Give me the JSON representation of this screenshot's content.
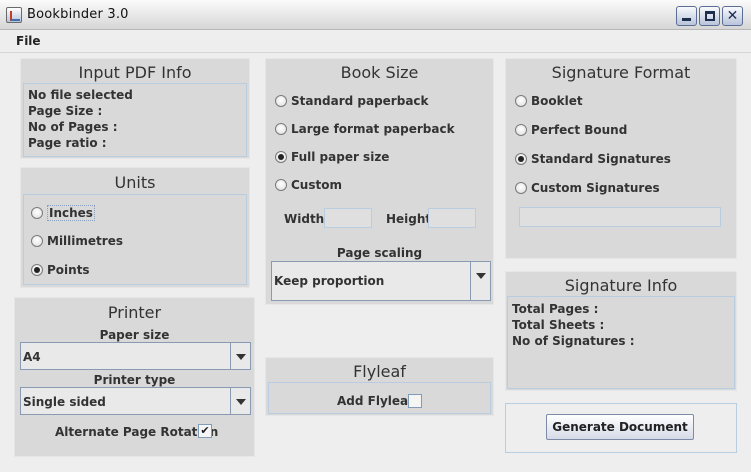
{
  "window": {
    "title": "Bookbinder 3.0"
  },
  "menu": {
    "file": "File"
  },
  "input_pdf": {
    "title": "Input PDF Info",
    "lines": [
      "No file selected",
      "Page Size :",
      "No of Pages :",
      "Page ratio :"
    ]
  },
  "units": {
    "title": "Units",
    "options": [
      "Inches",
      "Millimetres",
      "Points"
    ],
    "selected": "Points"
  },
  "printer": {
    "title": "Printer",
    "paper_size_label": "Paper size",
    "paper_size_value": "A4",
    "printer_type_label": "Printer type",
    "printer_type_value": "Single sided",
    "alternate_rotation_label": "Alternate Page Rotation",
    "alternate_rotation_checked": true
  },
  "book_size": {
    "title": "Book Size",
    "options": [
      "Standard paperback",
      "Large format paperback",
      "Full paper size",
      "Custom"
    ],
    "selected": "Full paper size",
    "width_label": "Width",
    "height_label": "Height",
    "page_scaling_label": "Page scaling",
    "page_scaling_value": "Keep proportion"
  },
  "flyleaf": {
    "title": "Flyleaf",
    "add_label": "Add Flyleaf",
    "checked": false
  },
  "signature_format": {
    "title": "Signature Format",
    "options": [
      "Booklet",
      "Perfect Bound",
      "Standard Signatures",
      "Custom Signatures"
    ],
    "selected": "Standard Signatures"
  },
  "signature_info": {
    "title": "Signature Info",
    "lines": [
      "Total Pages :",
      "Total Sheets :",
      "No of Signatures :"
    ]
  },
  "generate_button": "Generate Document"
}
